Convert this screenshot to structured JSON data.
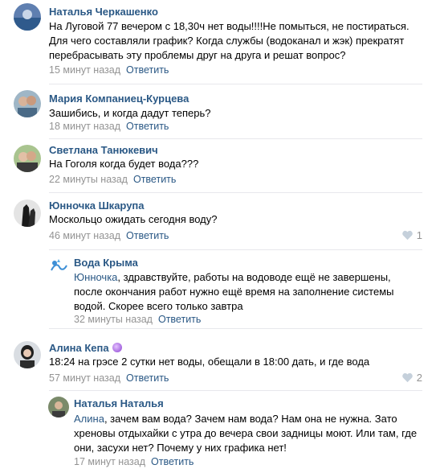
{
  "comments": [
    {
      "author": "Наталья Черкашенко",
      "text": "На Луговой 77 вечером с 18,30ч нет воды!!!!Не помыться, не постираться. Для чего составляли график? Когда службы (водоканал и жэк) прекратят перебрасывать эту проблемы друг на друга и решат вопрос?",
      "time": "15 минут назад",
      "reply": "Ответить"
    },
    {
      "author": "Мария Компаниец-Курцева",
      "text": "Зашибись, и когда дадут теперь?",
      "time": "18 минут назад",
      "reply": "Ответить"
    },
    {
      "author": "Светлана Танюкевич",
      "text": "На Гоголя когда будет вода???",
      "time": "22 минуты назад",
      "reply": "Ответить"
    },
    {
      "author": "Юнночка Шкарупа",
      "text": "Москольцо ожидать сегодня воду?",
      "time": "46 минут назад",
      "reply": "Ответить",
      "likes": "1"
    },
    {
      "author": "Вода Крыма",
      "mention": "Юнночка",
      "text": ", здравствуйте, работы на водоводе ещё не завершены, после окончания работ нужно ещё время на заполнение системы водой. Скорее всего только завтра",
      "time": "32 минуты назад",
      "reply": "Ответить"
    },
    {
      "author": "Алина Кепа",
      "text": "18:24 на грэсе 2 сутки нет воды, обещали в 18:00 дать, и где вода",
      "time": "57 минут назад",
      "reply": "Ответить",
      "likes": "2"
    },
    {
      "author": "Наталья Наталья",
      "mention": "Алина",
      "text": ", зачем вам вода? Зачем нам вода? Нам она не нужна. Зато хреновы отдыхайки с утра до вечера свои задницы моют. Или там, где они, засухи нет? Почему у них графика нет!",
      "time": "17 минут назад",
      "reply": "Ответить"
    }
  ],
  "colors": {
    "link": "#2a5885",
    "muted": "#939393",
    "divider": "#e7e8ec"
  }
}
